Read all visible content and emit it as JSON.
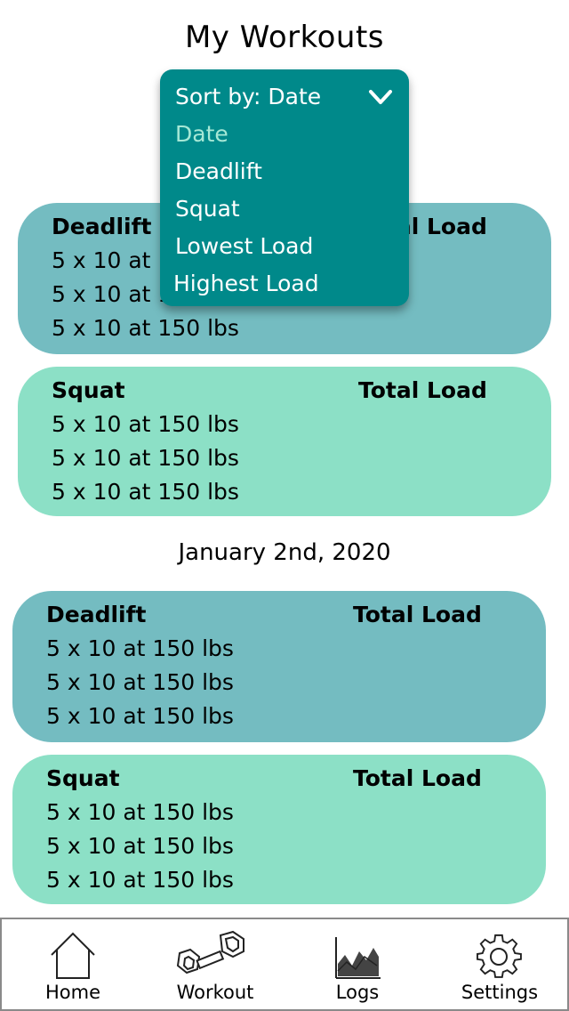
{
  "header": {
    "title": "My Workouts"
  },
  "sort": {
    "label": "Sort by: Date",
    "options": [
      "Date",
      "Deadlift",
      "Squat",
      "Lowest Load",
      "Highest Load"
    ],
    "selected": "Date"
  },
  "groups": [
    {
      "date": "",
      "workouts": [
        {
          "name": "Deadlift",
          "load_label": "Total Load",
          "sets": [
            "5 x 10 at 150 lbs",
            "5 x 10 at 150 lbs",
            "5 x 10 at 150 lbs"
          ]
        },
        {
          "name": "Squat",
          "load_label": "Total Load",
          "sets": [
            "5 x 10 at 150 lbs",
            "5 x 10 at 150 lbs",
            "5 x 10 at 150 lbs"
          ]
        }
      ]
    },
    {
      "date": "January 2nd, 2020",
      "workouts": [
        {
          "name": "Deadlift",
          "load_label": "Total Load",
          "sets": [
            "5 x 10 at 150 lbs",
            "5 x 10 at 150 lbs",
            "5 x 10 at 150 lbs"
          ]
        },
        {
          "name": "Squat",
          "load_label": "Total Load",
          "sets": [
            "5 x 10 at 150 lbs",
            "5 x 10 at 150 lbs",
            "5 x 10 at 150 lbs"
          ]
        }
      ]
    }
  ],
  "nav": {
    "items": [
      {
        "label": "Home",
        "icon": "home-icon"
      },
      {
        "label": "Workout",
        "icon": "dumbbell-icon"
      },
      {
        "label": "Logs",
        "icon": "chart-icon"
      },
      {
        "label": "Settings",
        "icon": "gear-icon"
      }
    ]
  },
  "colors": {
    "deadlift_card": "#74bcc1",
    "squat_card": "#8ce0c6",
    "dropdown_bg": "#00898a",
    "dropdown_active": "#a6e8d6"
  }
}
